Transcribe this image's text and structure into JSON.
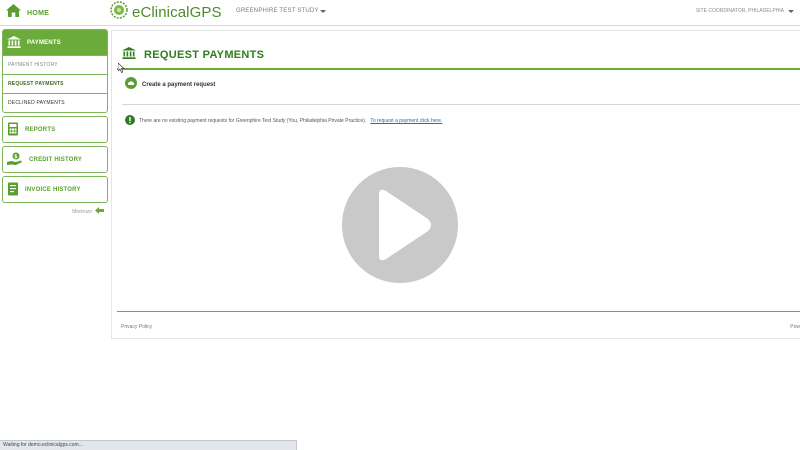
{
  "topbar": {
    "home_label": "HOME",
    "logo_text": "eClinicalGPS",
    "study_selector": "GREENPHIRE TEST STUDY",
    "user_menu": "SITE COORDINATOR, PHILADELPHIA"
  },
  "sidebar": {
    "payments": {
      "label": "PAYMENTS",
      "items": [
        {
          "label": "PAYMENT HISTORY"
        },
        {
          "label": "REQUEST PAYMENTS"
        },
        {
          "label": "DECLINED PAYMENTS"
        }
      ]
    },
    "reports_label": "REPORTS",
    "credit_history_label": "CREDIT HISTORY",
    "invoice_history_label": "INVOICE HISTORY",
    "minimize_label": "Minimize"
  },
  "main": {
    "title": "REQUEST PAYMENTS",
    "create_label": "Create a payment request",
    "notice_text": "There are no existing payment requests for Greenphire Test Study (You, Philadelphia Private Practice).",
    "notice_link": "To request a payment click here."
  },
  "footer": {
    "privacy": "Privacy Policy",
    "powered": "Pow"
  },
  "status_bar": "Waiting for demo.eclinicalgps.com...",
  "colors": {
    "brand_green": "#6aab3a",
    "title_green": "#2f7d1e",
    "link_blue": "#2f6aa8"
  }
}
